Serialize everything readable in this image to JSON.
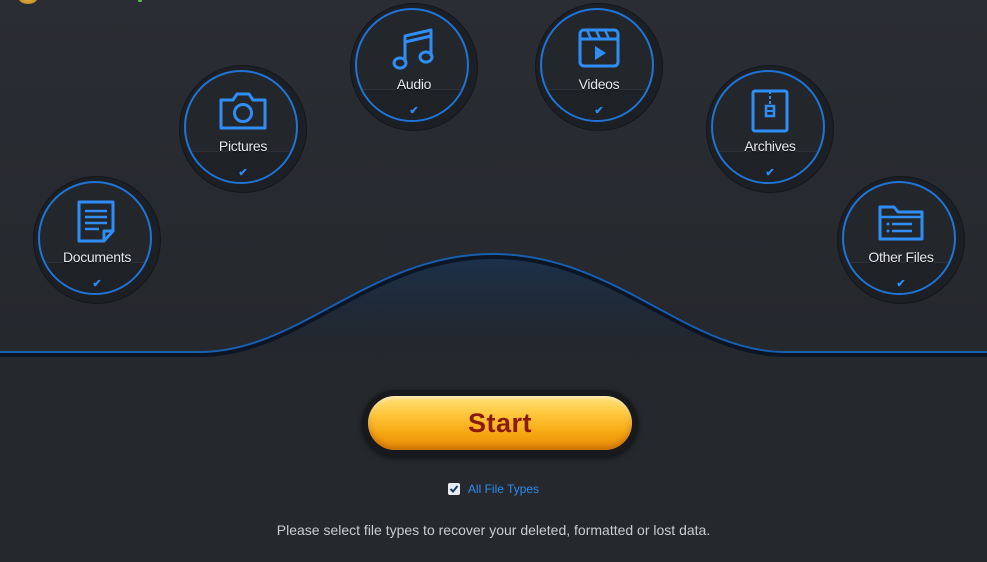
{
  "file_types": [
    {
      "key": "documents",
      "label": "Documents",
      "icon": "document-icon",
      "checked": true,
      "check_mark": "✔"
    },
    {
      "key": "pictures",
      "label": "Pictures",
      "icon": "camera-icon",
      "checked": true,
      "check_mark": "✔"
    },
    {
      "key": "audio",
      "label": "Audio",
      "icon": "music-note-icon",
      "checked": true,
      "check_mark": "✔"
    },
    {
      "key": "videos",
      "label": "Videos",
      "icon": "video-clapper-icon",
      "checked": true,
      "check_mark": "✔"
    },
    {
      "key": "archives",
      "label": "Archives",
      "icon": "zip-archive-icon",
      "checked": true,
      "check_mark": "✔"
    },
    {
      "key": "other_files",
      "label": "Other Files",
      "icon": "folder-list-icon",
      "checked": true,
      "check_mark": "✔"
    }
  ],
  "start_button": {
    "label": "Start"
  },
  "all_file_types": {
    "label": "All File Types",
    "checked": true
  },
  "hint_text": "Please select file types to recover your deleted, formatted or lost data.",
  "colors": {
    "accent_blue": "#1f74d6",
    "start_orange": "#f6a611",
    "start_text": "#8a1b0a",
    "background": "#26292e"
  }
}
